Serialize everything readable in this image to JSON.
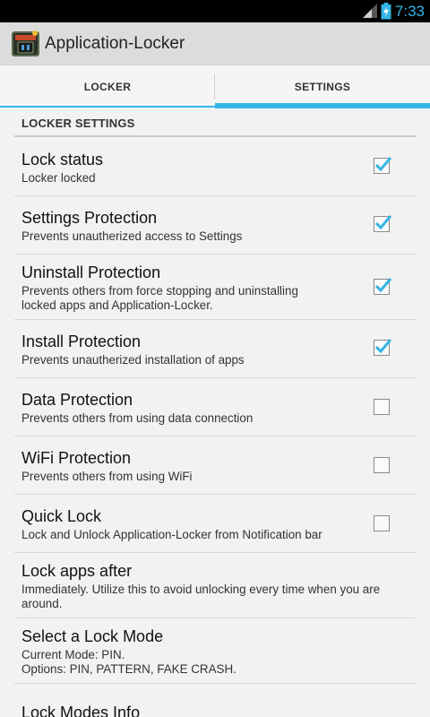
{
  "status_bar": {
    "time": "7:33"
  },
  "app_bar": {
    "title": "Application-Locker"
  },
  "tabs": [
    {
      "label": "LOCKER",
      "selected": false
    },
    {
      "label": "SETTINGS",
      "selected": true
    }
  ],
  "category": "LOCKER SETTINGS",
  "prefs": [
    {
      "title": "Lock status",
      "summary": "Locker locked",
      "checked": true
    },
    {
      "title": "Settings Protection",
      "summary": "Prevents unautherized access to Settings",
      "checked": true
    },
    {
      "title": "Uninstall Protection",
      "summary": "Prevents others from force stopping and uninstalling locked apps and Application-Locker.",
      "checked": true
    },
    {
      "title": "Install Protection",
      "summary": "Prevents unautherized installation of apps",
      "checked": true
    },
    {
      "title": "Data Protection",
      "summary": "Prevents others from using data connection",
      "checked": false
    },
    {
      "title": "WiFi Protection",
      "summary": "Prevents others from using WiFi",
      "checked": false
    },
    {
      "title": "Quick Lock",
      "summary": "Lock and Unlock Application-Locker from Notification bar",
      "checked": false
    },
    {
      "title": "Lock apps after",
      "summary": "Immediately. Utilize this to avoid unlocking every time when you are around."
    },
    {
      "title": "Select a Lock Mode",
      "summary_line1": "Current Mode: PIN.",
      "summary_line2": "Options: PIN, PATTERN, FAKE CRASH."
    },
    {
      "title": "Lock Modes Info"
    }
  ],
  "colors": {
    "accent": "#33b5e5"
  },
  "icons": {
    "signal": "signal-icon",
    "battery": "battery-charging-icon",
    "app": "locker-app-icon",
    "check": "check-icon"
  }
}
